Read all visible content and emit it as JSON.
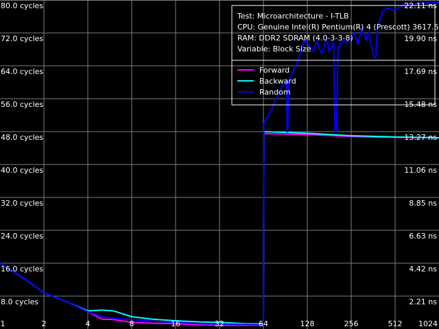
{
  "chart_data": {
    "type": "line",
    "x_scale": "log2",
    "xlim": [
      1,
      1024
    ],
    "ylim": [
      0,
      80
    ],
    "grid": true,
    "legend_placement": "top-right",
    "x_ticks": [
      "1",
      "2",
      "4",
      "8",
      "16",
      "32",
      "64",
      "128",
      "256",
      "512",
      "1024"
    ],
    "y_ticks_left": [
      "8.0 cycles",
      "16.0 cycles",
      "24.0 cycles",
      "32.0 cycles",
      "40.0 cycles",
      "48.0 cycles",
      "56.0 cycles",
      "64.0 cycles",
      "72.0 cycles",
      "80.0 cycles"
    ],
    "y_ticks_right": [
      "2.21 ns",
      "4.42 ns",
      "6.63 ns",
      "8.85 ns",
      "11.06 ns",
      "13.27 ns",
      "15.48 ns",
      "17.69 ns",
      "19.90 ns",
      "22.11 ns"
    ],
    "info": [
      "Test: Microarchitecture - I-TLB",
      "CPU: Genuine Intel(R) Pentium(R) 4 (Prescott) 3617.5 MHz",
      "RAM: DDR2 SDRAM (4.0-3-3-8)",
      "Variable: Block Size"
    ],
    "series": [
      {
        "name": "Forward",
        "color": "#ff00ff",
        "x": [
          1,
          1.5,
          2,
          3,
          4,
          5,
          6,
          8,
          11,
          16,
          24,
          32,
          48,
          63,
          64,
          64.5,
          128,
          256,
          512,
          1024
        ],
        "y": [
          16,
          12,
          8.8,
          6.3,
          4.2,
          2.4,
          2.3,
          1.6,
          1.4,
          1.3,
          1.0,
          0.9,
          0.9,
          0.9,
          0.9,
          47.5,
          47.3,
          46.8,
          46.6,
          46.5
        ]
      },
      {
        "name": "Backward",
        "color": "#00ffff",
        "x": [
          1,
          1.5,
          2,
          3,
          4,
          5,
          6,
          8,
          11,
          16,
          24,
          32,
          48,
          63,
          64,
          64.5,
          128,
          256,
          512,
          1024
        ],
        "y": [
          16,
          12,
          8.8,
          6.3,
          4.4,
          4.6,
          4.4,
          3.0,
          2.4,
          2.0,
          1.7,
          1.6,
          1.3,
          1.2,
          1.2,
          48,
          47.6,
          47.0,
          46.7,
          46.5
        ]
      },
      {
        "name": "Random",
        "color": "#0000ff",
        "x": [
          1,
          1.5,
          2,
          3,
          4,
          5,
          6,
          8,
          11,
          16,
          24,
          32,
          48,
          63,
          64,
          64.5,
          68,
          72,
          76,
          84,
          92,
          93,
          94,
          95,
          96,
          104,
          111,
          117,
          123,
          130,
          140,
          149,
          160,
          166,
          174,
          181,
          189,
          194,
          198,
          203,
          208,
          212,
          222,
          237,
          253,
          271,
          283,
          303,
          324,
          338,
          354,
          366,
          378,
          387,
          424,
          453,
          496,
          553,
          617,
          676,
          755,
          843,
          925,
          1024
        ],
        "y": [
          16,
          12,
          8.8,
          6.3,
          4.2,
          3.0,
          2.6,
          2.3,
          1.9,
          1.6,
          1.3,
          1.2,
          1.1,
          1.0,
          1.0,
          50,
          51.7,
          53,
          55,
          58.3,
          60.3,
          48,
          48,
          60,
          60.3,
          63.3,
          65.3,
          68.3,
          70.3,
          69.2,
          67.5,
          70,
          67,
          68.3,
          70.8,
          67.5,
          68.7,
          70,
          48,
          48,
          68.7,
          68.3,
          70.3,
          69.7,
          70.8,
          72,
          69.2,
          73,
          70.3,
          72.5,
          68.3,
          66,
          66.2,
          73.3,
          77.5,
          78,
          77.5,
          78.3,
          79.2,
          78.7,
          79.3,
          79.2,
          79.5,
          79.3
        ]
      }
    ]
  }
}
